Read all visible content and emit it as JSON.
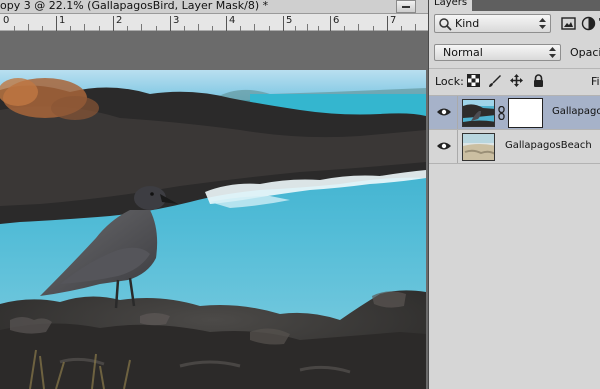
{
  "document": {
    "title": "opy 3 @ 22.1% (GallapagosBird, Layer Mask/8) *",
    "ruler_marks": [
      "0",
      "1",
      "2",
      "3",
      "4",
      "5",
      "6",
      "7"
    ]
  },
  "layers_panel": {
    "tab_label": "Layers",
    "filter": {
      "kind_label": "Kind",
      "icons": [
        "image-filter-icon",
        "adjustment-filter-icon",
        "type-filter-icon"
      ]
    },
    "blend_mode": "Normal",
    "opacity_label": "Opacity",
    "lock_label": "Lock:",
    "lock_icons": [
      "lock-transparent-pixels-icon",
      "lock-image-pixels-icon",
      "lock-position-icon",
      "lock-all-icon"
    ],
    "fill_label": "Fil",
    "layers": [
      {
        "name": "Gallapagos",
        "visible": true,
        "selected": true,
        "has_mask": true
      },
      {
        "name": "GallapagosBeach",
        "visible": true,
        "selected": false,
        "has_mask": false
      }
    ]
  },
  "colors": {
    "selected_layer": "#a6b2c9",
    "panel_bg": "#d6d6d6",
    "workspace_bg": "#6b6b6b"
  }
}
